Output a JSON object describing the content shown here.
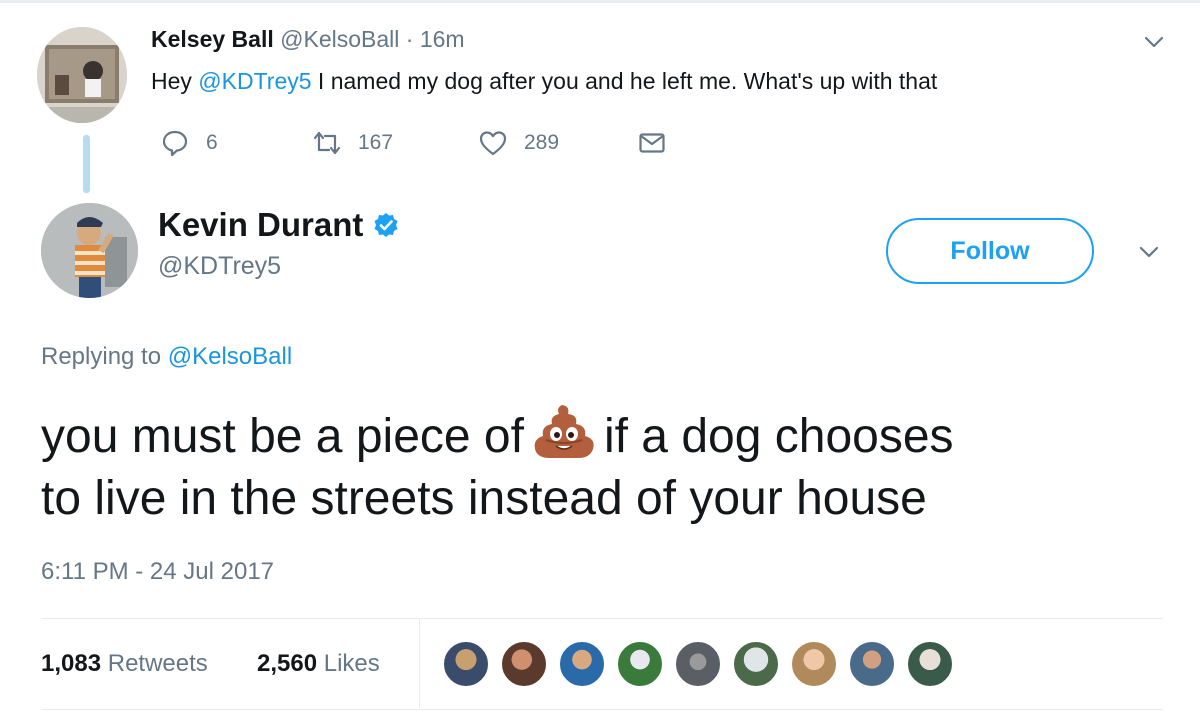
{
  "parent_tweet": {
    "name": "Kelsey Ball",
    "handle": "@KelsoBall",
    "separator": "·",
    "time": "16m",
    "text_before": "Hey ",
    "mention": "@KDTrey5",
    "text_after": " I named my dog after you and he left me. What's up with that",
    "replies": "6",
    "retweets": "167",
    "likes": "289",
    "icons": [
      "reply-icon",
      "retweet-icon",
      "heart-icon",
      "envelope-icon",
      "chevron-down-icon"
    ]
  },
  "reply_tweet": {
    "name": "Kevin Durant",
    "handle": "@KDTrey5",
    "verified_icon": "verified-badge-icon",
    "follow_label": "Follow",
    "replying_prefix": "Replying to",
    "replying_to": "@KelsoBall",
    "text_line1_before": "you must be a piece of",
    "emoji": "pile-of-poo-emoji",
    "text_line1_after": "if a dog chooses",
    "text_line2": "to live in the streets instead of your house",
    "timestamp": "6:11 PM - 24 Jul 2017",
    "retweet_count": "1,083",
    "retweet_label": "Retweets",
    "like_count": "2,560",
    "like_label": "Likes",
    "liker_avatar_count": 9
  },
  "colors": {
    "accent": "#1da1f2",
    "link": "#1b95e0",
    "muted": "#657786",
    "text": "#14171a",
    "thread_line": "#b8dcef",
    "divider": "#e6ecf0"
  }
}
